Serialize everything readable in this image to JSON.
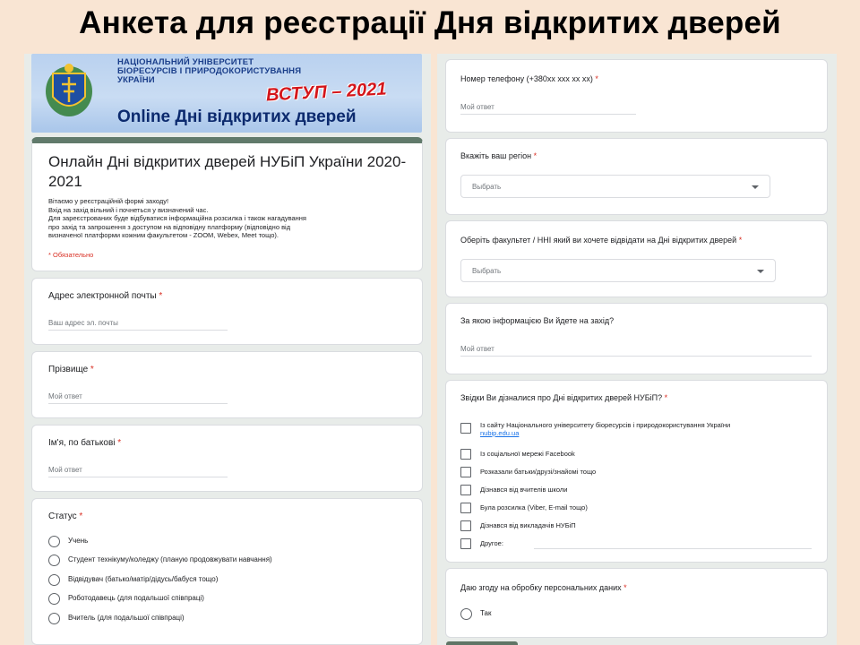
{
  "slide": {
    "title": "Анкета для реєстрації Дня відкритих дверей"
  },
  "banner": {
    "university_line1": "НАЦІОНАЛЬНИЙ УНІВЕРСИТЕТ",
    "university_line2": "БІОРЕСУРСІВ І ПРИРОДОКОРИСТУВАННЯ",
    "university_line3": "УКРАЇНИ",
    "campaign": "ВСТУП – 2021",
    "subtitle": "Online Дні відкритих дверей"
  },
  "form": {
    "title": "Онлайн Дні відкритих дверей НУБіП України 2020-2021",
    "description": [
      "Вітаємо у реєстраційній формі заходу!",
      "Вхід на захід вільний і почнеться у визначений час.",
      "Для зареєстрованих буде відбуватися інформаційна розсилка і також нагадування",
      "про захід та запрошення з доступом на відповідну платформу (відповідно від",
      "визначеної платформи кожним факультетом - ZOOM, Webex, Meet тощо)."
    ],
    "required_note": "* Обязательно"
  },
  "questions": {
    "email": {
      "label": "Адрес электронной почты",
      "placeholder": "Ваш адрес эл. почты"
    },
    "surname": {
      "label": "Прізвище",
      "placeholder": "Мой ответ"
    },
    "name": {
      "label": "Ім'я, по батькові",
      "placeholder": "Мой ответ"
    },
    "status": {
      "label": "Статус",
      "options": [
        "Учень",
        "Студент технікуму/коледжу (планую продовжувати навчання)",
        "Відвідувач (батько/матір/дідусь/бабуся тощо)",
        "Роботодавець (для подальшої співпраці)",
        "Вчитель (для подальшої співпраці)"
      ]
    },
    "phone": {
      "label": "Номер телефону (+380хх ххх хх хх)",
      "placeholder": "Мой ответ"
    },
    "region": {
      "label": "Вкажіть ваш регіон",
      "selected": "Выбрать"
    },
    "faculty": {
      "label": "Оберіть факультет / ННІ який ви хочете відвідати на Дні відкритих дверей",
      "selected": "Выбрать"
    },
    "info": {
      "label": "За якою інформацією Ви йдете на захід?",
      "placeholder": "Мой ответ"
    },
    "source": {
      "label": "Звідки Ви дізналися про Дні відкритих дверей НУБіП?",
      "option1_text": "Із сайту Національного університету біоресурсів і природокористування України",
      "option1_link": "nubip.edu.ua",
      "options": [
        "Із соціальної мережі Facebook",
        "Розказали батьки/друзі/знайомі тощо",
        "Дізнався від вчителів школи",
        "Була розсилка (Viber, E-mail тощо)",
        "Дізнався від викладачів НУБіП",
        "Другое:"
      ]
    },
    "consent": {
      "label": "Даю згоду на обробку персональних даних",
      "options": [
        "Так"
      ]
    }
  },
  "required_mark": "*",
  "colors": {
    "accent": "#617a6b",
    "required": "#d93025",
    "background": "#f9e5d3"
  }
}
